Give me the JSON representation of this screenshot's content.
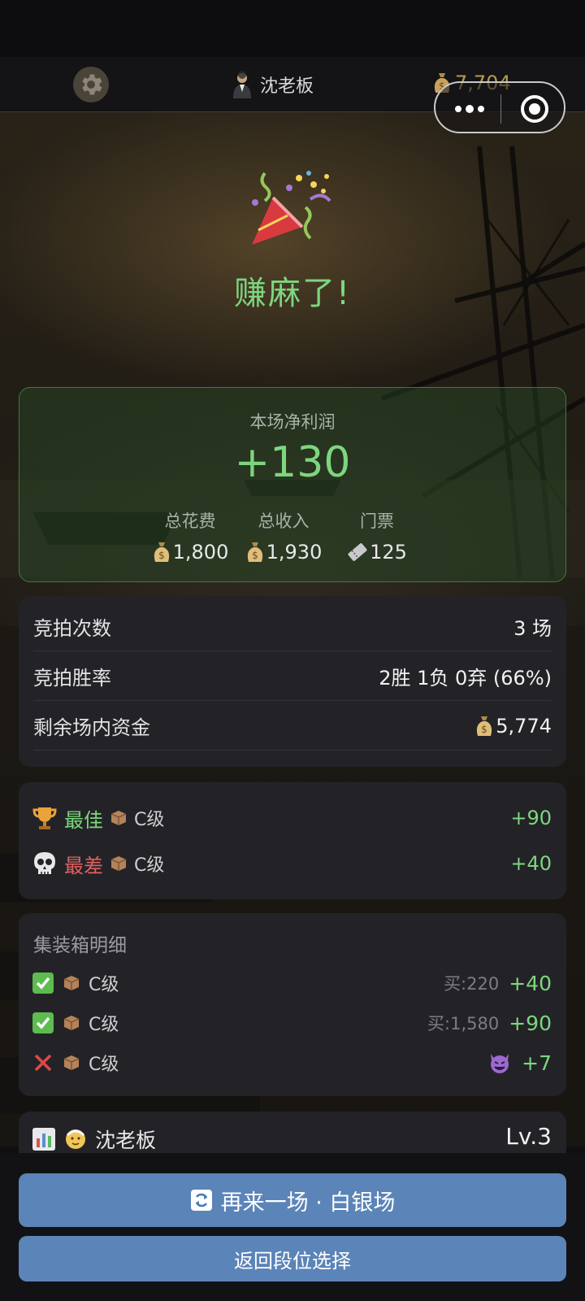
{
  "header": {
    "player_name": "沈老板",
    "coins": "7,704"
  },
  "hero": {
    "title": "赚麻了!"
  },
  "profit": {
    "label": "本场净利润",
    "value": "+130",
    "cols": [
      {
        "label": "总花费",
        "value": "1,800",
        "icon": "money-bag-icon"
      },
      {
        "label": "总收入",
        "value": "1,930",
        "icon": "money-bag-icon"
      },
      {
        "label": "门票",
        "value": "125",
        "icon": "ticket-icon"
      }
    ]
  },
  "stats": {
    "rows": [
      {
        "label": "竞拍次数",
        "value": "3 场"
      },
      {
        "label": "竞拍胜率",
        "value": "2胜 1负 0弃 (66%)"
      },
      {
        "label": "剩余场内资金",
        "value": "5,774"
      }
    ]
  },
  "best_worst": {
    "best": {
      "label": "最佳",
      "grade": "C级",
      "value": "+90"
    },
    "worst": {
      "label": "最差",
      "grade": "C级",
      "value": "+40"
    }
  },
  "details": {
    "title": "集装箱明细",
    "rows": [
      {
        "status": "check",
        "grade": "C级",
        "buy": "买:220",
        "gain": "+40"
      },
      {
        "status": "check",
        "grade": "C级",
        "buy": "买:1,580",
        "gain": "+90"
      },
      {
        "status": "cross",
        "grade": "C级",
        "buy": "",
        "gain": "+7"
      }
    ]
  },
  "level": {
    "name": "沈老板",
    "value": "Lv.3"
  },
  "buttons": {
    "again": "再来一场 · 白银场",
    "back": "返回段位选择"
  },
  "colors": {
    "accent_green": "#7dd67f",
    "accent_red": "#e06060",
    "button_blue": "#5b84b8",
    "coin_gold": "#b89b4c"
  }
}
